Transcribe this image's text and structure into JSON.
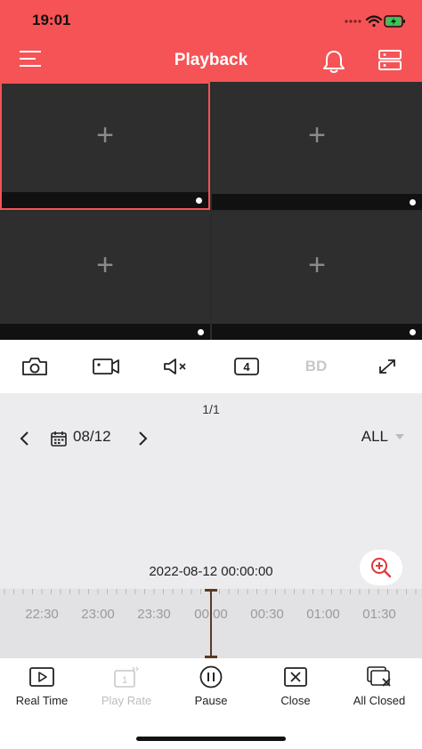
{
  "status_bar": {
    "time": "19:01"
  },
  "header": {
    "title": "Playback",
    "bg_color": "#f65356",
    "menu_icon": "hamburger-menu-icon",
    "bell_icon": "bell-icon",
    "device_icon": "device-list-icon"
  },
  "grid": {
    "tiles": [
      {
        "add_glyph": "+",
        "selected": true
      },
      {
        "add_glyph": "+",
        "selected": false
      },
      {
        "add_glyph": "+",
        "selected": false
      },
      {
        "add_glyph": "+",
        "selected": false
      }
    ]
  },
  "toolbar": {
    "snapshot_icon": "camera-icon",
    "record_icon": "video-record-icon",
    "mute_icon": "speaker-muted-icon",
    "split_label": "4",
    "quality_label": "BD",
    "fullscreen_icon": "fullscreen-icon"
  },
  "timeline": {
    "page_indicator": "1/1",
    "date": "08/12",
    "filter": "ALL",
    "timestamp": "2022-08-12 00:00:00",
    "tick_labels": [
      "22:30",
      "23:00",
      "23:30",
      "00:00",
      "00:30",
      "01:00",
      "01:30"
    ],
    "cursor_color": "#5a3a22"
  },
  "bottom_nav": {
    "items": [
      {
        "label": "Real Time",
        "icon": "play-square-icon",
        "enabled": true
      },
      {
        "label": "Play Rate",
        "icon": "play-rate-icon",
        "enabled": false
      },
      {
        "label": "Pause",
        "icon": "pause-circle-icon",
        "enabled": true
      },
      {
        "label": "Close",
        "icon": "close-square-icon",
        "enabled": true
      },
      {
        "label": "All Closed",
        "icon": "close-all-icon",
        "enabled": true
      }
    ]
  }
}
